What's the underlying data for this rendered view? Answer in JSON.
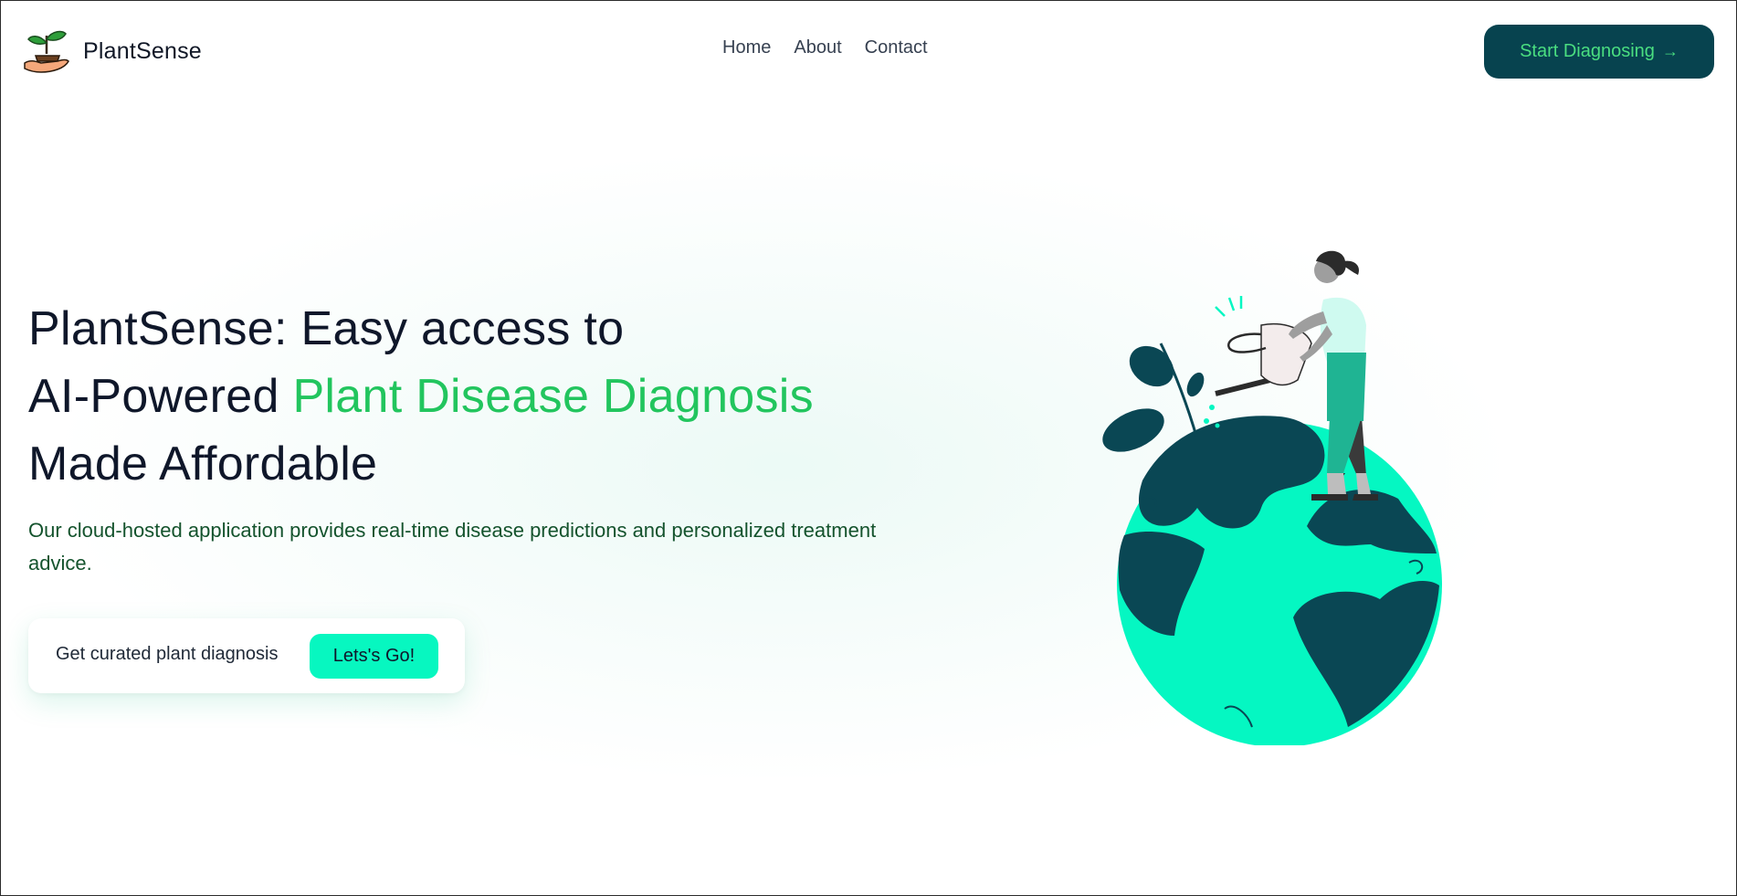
{
  "brand": {
    "name": "PlantSense",
    "logo_icon": "plant-in-hand-icon"
  },
  "nav": {
    "links": [
      "Home",
      "About",
      "Contact"
    ]
  },
  "header_cta": {
    "label": "Start Diagnosing",
    "arrow": "→"
  },
  "hero": {
    "title_line1": "PlantSense: Easy access to",
    "title_line2_prefix": "AI-Powered ",
    "title_line2_accent": "Plant Disease Diagnosis",
    "title_line3": "Made Affordable",
    "subtitle": "Our cloud-hosted application provides real-time disease predictions and personalized treatment advice.",
    "card_label": "Get curated plant diagnosis",
    "card_button": "Lets's Go!"
  },
  "illustration": {
    "icon": "woman-watering-plant-on-globe-illustration"
  },
  "colors": {
    "primary_dark": "#07434f",
    "accent_green": "#22c55e",
    "button_mint": "#07f7c0",
    "globe_land": "#0a4754",
    "globe_sea": "#05f7c2"
  }
}
